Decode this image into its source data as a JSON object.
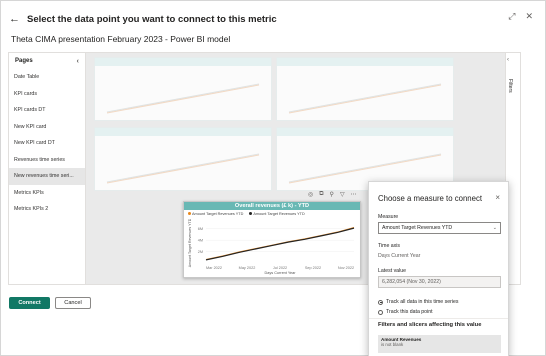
{
  "dialog": {
    "title": "Select the data point you want to connect to this metric",
    "subtitle": "Theta CIMA presentation February 2023 - Power BI model",
    "back_icon": "←",
    "expand_icon": "⤢",
    "close_icon": "✕"
  },
  "pages": {
    "header": "Pages",
    "collapse_icon": "‹",
    "items": [
      {
        "label": "Date Table"
      },
      {
        "label": "KPI cards"
      },
      {
        "label": "KPI cards DT"
      },
      {
        "label": "New KPI card"
      },
      {
        "label": "New KPI card DT"
      },
      {
        "label": "Revenues time series"
      },
      {
        "label": "New revenues time seri..."
      },
      {
        "label": "Metrics KPIs"
      },
      {
        "label": "Metrics KPIs 2"
      }
    ],
    "active_index": 6
  },
  "filters_pane": {
    "label": "Filters",
    "expand_icon": "‹"
  },
  "chart": {
    "title": "Overall revenues (£ k) - YTD",
    "legend": [
      {
        "name": "Amount Target Revenues YTD",
        "color": "#e8861a"
      },
      {
        "name": "Amount Target Revenues YTD",
        "color": "#252423"
      }
    ],
    "tools": [
      "◎",
      "⧉",
      "⚲",
      "▽",
      "⋯"
    ],
    "chart_data": {
      "type": "line",
      "title": "Overall revenues (£ k) - YTD",
      "xlabel": "Days Current Year",
      "ylabel": "Amount Target Revenues YTD",
      "x_ticks": [
        "Mar 2022",
        "May 2022",
        "Jul 2022",
        "Sep 2022",
        "Nov 2022"
      ],
      "y_ticks": [
        "2M",
        "4M",
        "6M"
      ],
      "ylim": [
        0,
        7
      ],
      "series": [
        {
          "name": "Amount Target Revenues YTD",
          "color": "#e8861a",
          "x": [
            0,
            1,
            2,
            3,
            4,
            5,
            6,
            7,
            8,
            9
          ],
          "values": [
            0.6,
            1.2,
            1.9,
            2.5,
            3.1,
            3.7,
            4.2,
            4.8,
            5.4,
            6.2
          ]
        },
        {
          "name": "Amount Target Revenues YTD",
          "color": "#252423",
          "x": [
            0,
            1,
            2,
            3,
            4,
            5,
            6,
            7,
            8,
            9
          ],
          "values": [
            0.55,
            1.15,
            1.85,
            2.45,
            3.05,
            3.65,
            4.15,
            4.75,
            5.35,
            6.1
          ]
        }
      ]
    }
  },
  "measure": {
    "title": "Choose a measure to connect",
    "close_icon": "×",
    "measure_label": "Measure",
    "measure_value": "Amount Target Revenues YTD",
    "time_axis_label": "Time axis",
    "time_axis_value": "Days Current Year",
    "latest_label": "Latest value",
    "latest_value": "6,282,054 (Nov 30, 2022)",
    "radio_all": "Track all data in this time series",
    "radio_point": "Track this data point",
    "filters_title": "Filters and slicers affecting this value",
    "filter_name": "Amount Revenues",
    "filter_value": "is not blank"
  },
  "footer": {
    "connect_label": "Connect",
    "cancel_label": "Cancel"
  }
}
